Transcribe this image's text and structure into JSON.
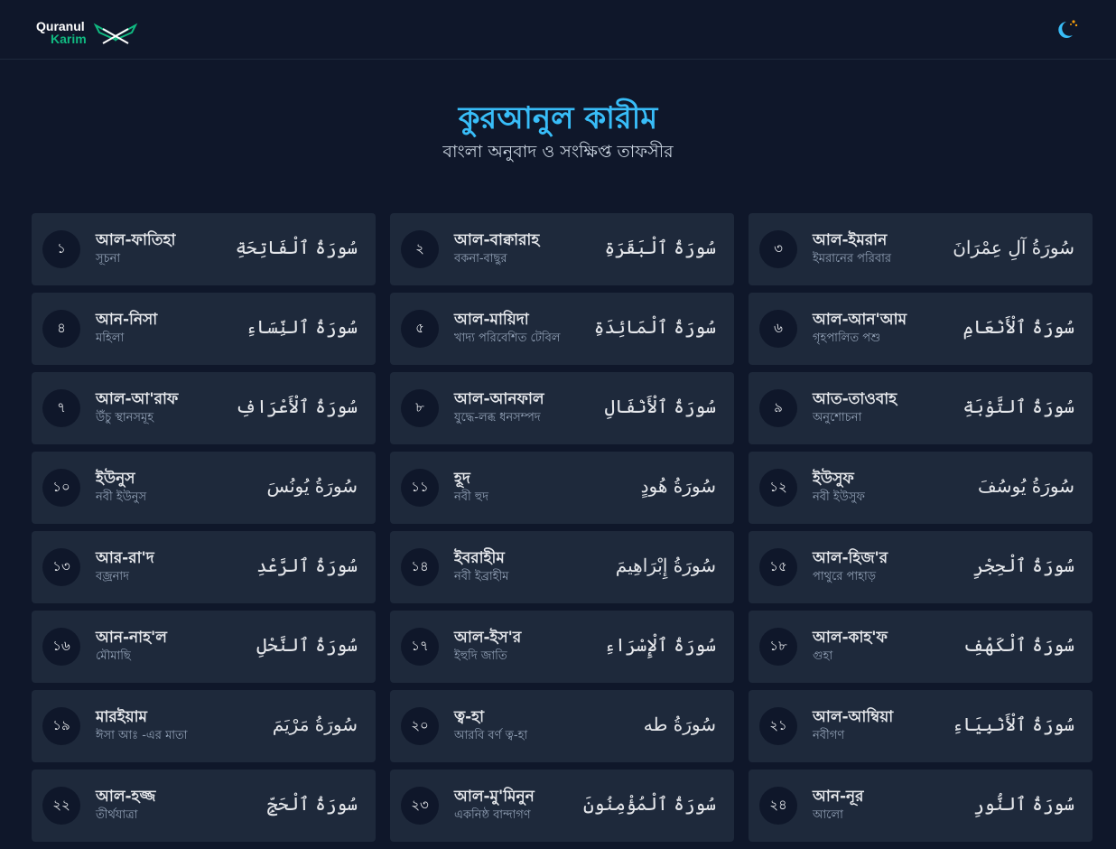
{
  "header": {
    "logo_line1": "Quranul",
    "logo_line2": "Karim",
    "theme_icon": "moon-icon"
  },
  "hero": {
    "title": "কুরআনুল কারীম",
    "subtitle": "বাংলা অনুবাদ ও সংক্ষিপ্ত তাফসীর"
  },
  "colors": {
    "background": "#0f172a",
    "card": "#1e293b",
    "accent_title": "#38bdf8",
    "logo_green": "#10b981"
  },
  "surahs": [
    {
      "number": "১",
      "name": "আল-ফাতিহা",
      "meaning": "সূচনা",
      "arabic": "سُورَةُ ٱلْفَاتِحَةِ"
    },
    {
      "number": "২",
      "name": "আল-বাক্বারাহ",
      "meaning": "বকনা-বাছুর",
      "arabic": "سُورَةُ ٱلْبَقَرَةِ"
    },
    {
      "number": "৩",
      "name": "আল-ইমরান",
      "meaning": "ইমরানের পরিবার",
      "arabic": "سُورَةُ آلِ عِمْرَانَ"
    },
    {
      "number": "৪",
      "name": "আন-নিসা",
      "meaning": "মহিলা",
      "arabic": "سُورَةُ ٱلنِّسَاءِ"
    },
    {
      "number": "৫",
      "name": "আল-মায়িদা",
      "meaning": "খাদ্য পরিবেশিত টেবিল",
      "arabic": "سُورَةُ ٱلْمَائِدَةِ"
    },
    {
      "number": "৬",
      "name": "আল-আন'আম",
      "meaning": "গৃহপালিত পশু",
      "arabic": "سُورَةُ ٱلْأَنْعَامِ"
    },
    {
      "number": "৭",
      "name": "আল-আ'রাফ",
      "meaning": "উঁচু স্থানসমূহ",
      "arabic": "سُورَةُ ٱلْأَعْرَافِ"
    },
    {
      "number": "৮",
      "name": "আল-আনফাল",
      "meaning": "যুদ্ধে-লব্ধ ধনসম্পদ",
      "arabic": "سُورَةُ ٱلْأَنْفَالِ"
    },
    {
      "number": "৯",
      "name": "আত-তাওবাহ",
      "meaning": "অনুশোচনা",
      "arabic": "سُورَةُ ٱلتَّوْبَةِ"
    },
    {
      "number": "১০",
      "name": "ইউনুস",
      "meaning": "নবী ইউনুস",
      "arabic": "سُورَةُ يُونُسَ"
    },
    {
      "number": "১১",
      "name": "হূদ",
      "meaning": "নবী হুদ",
      "arabic": "سُورَةُ هُودٍ"
    },
    {
      "number": "১২",
      "name": "ইউসুফ",
      "meaning": "নবী ইউসুফ",
      "arabic": "سُورَةُ يُوسُفَ"
    },
    {
      "number": "১৩",
      "name": "আর-রা'দ",
      "meaning": "বজ্রনাদ",
      "arabic": "سُورَةُ ٱلرَّعْدِ"
    },
    {
      "number": "১৪",
      "name": "ইবরাহীম",
      "meaning": "নবী ইব্রাহীম",
      "arabic": "سُورَةُ إِبْرَاهِيمَ"
    },
    {
      "number": "১৫",
      "name": "আল-হিজ'র",
      "meaning": "পাথুরে পাহাড়",
      "arabic": "سُورَةُ ٱلْحِجْرِ"
    },
    {
      "number": "১৬",
      "name": "আন-নাহ'ল",
      "meaning": "মৌমাছি",
      "arabic": "سُورَةُ ٱلنَّحْلِ"
    },
    {
      "number": "১৭",
      "name": "আল-ইস'র",
      "meaning": "ইহুদি জাতি",
      "arabic": "سُورَةُ ٱلْإِسْرَاءِ"
    },
    {
      "number": "১৮",
      "name": "আল-কাহ'ফ",
      "meaning": "গুহা",
      "arabic": "سُورَةُ ٱلْكَهْفِ"
    },
    {
      "number": "১৯",
      "name": "মারইয়াম",
      "meaning": "ঈসা আঃ -এর মাতা",
      "arabic": "سُورَةُ مَرْيَمَ"
    },
    {
      "number": "২০",
      "name": "ত্ব-হা",
      "meaning": "আরবি বর্ণ ত্ব-হা",
      "arabic": "سُورَةُ طه"
    },
    {
      "number": "২১",
      "name": "আল-আম্বিয়া",
      "meaning": "নবীগণ",
      "arabic": "سُورَةُ ٱلْأَنْبِيَاءِ"
    },
    {
      "number": "২২",
      "name": "আল-হজ্জ",
      "meaning": "তীর্থযাত্রা",
      "arabic": "سُورَةُ ٱلْحَجِّ"
    },
    {
      "number": "২৩",
      "name": "আল-মু'মিনুন",
      "meaning": "একনিষ্ঠ বান্দাগণ",
      "arabic": "سُورَةُ ٱلْمُؤْمِنُونَ"
    },
    {
      "number": "২৪",
      "name": "আন-নূর",
      "meaning": "আলো",
      "arabic": "سُورَةُ ٱلنُّورِ"
    }
  ]
}
